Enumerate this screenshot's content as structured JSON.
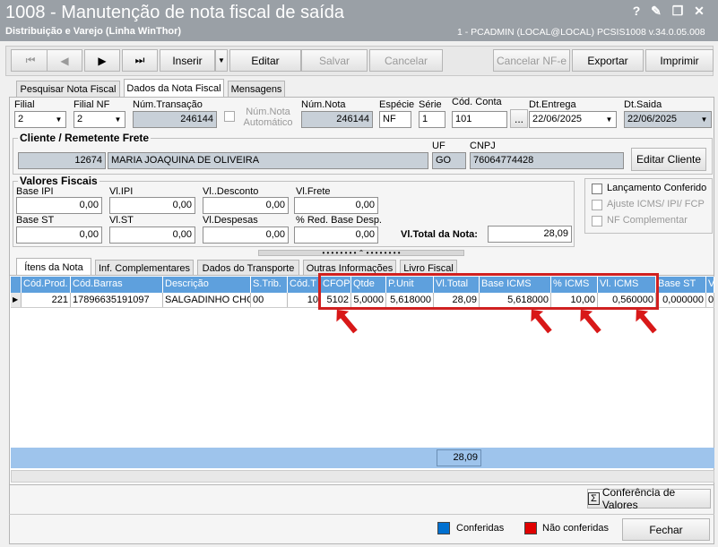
{
  "window": {
    "title": "1008 - Manutenção de nota fiscal de saída",
    "subtitle": "Distribuição e Varejo (Linha WinThor)",
    "user_info": "1 - PCADMIN (LOCAL@LOCAL)   PCSIS1008  v.34.0.05.008",
    "controls": [
      "?",
      "✎",
      "❐",
      "✕"
    ]
  },
  "toolbar": {
    "first": "⏮",
    "prev": "◀",
    "next": "▶",
    "last": "⏭",
    "inserir": "Inserir",
    "editar": "Editar",
    "salvar": "Salvar",
    "cancelar": "Cancelar",
    "cancelar_nfe": "Cancelar NF-e",
    "exportar": "Exportar",
    "imprimir": "Imprimir"
  },
  "main_tabs": [
    "Pesquisar Nota Fiscal",
    "Dados da Nota Fiscal",
    "Mensagens"
  ],
  "form": {
    "filial_label": "Filial",
    "filial_value": "2",
    "filial_nf_label": "Filial NF",
    "filial_nf_value": "2",
    "num_transacao_label": "Núm.Transação",
    "num_transacao_value": "246144",
    "num_nota_auto_label": "Núm.Nota Automático",
    "num_nota_label": "Núm.Nota",
    "num_nota_value": "246144",
    "especie_label": "Espécie",
    "especie_value": "NF",
    "serie_label": "Série",
    "serie_value": "1",
    "cod_conta_label": "Cód. Conta",
    "cod_conta_value": "101",
    "cod_conta_btn": "...",
    "dt_entrega_label": "Dt.Entrega",
    "dt_entrega_value": "22/06/2025",
    "dt_saida_label": "Dt.Saida",
    "dt_saida_value": "22/06/2025"
  },
  "cliente": {
    "title": "Cliente / Remetente Frete",
    "uf_label": "UF",
    "cnpj_label": "CNPJ",
    "codigo": "12674",
    "nome": "MARIA JOAQUINA DE OLIVEIRA",
    "uf": "GO",
    "cnpj": "76064774428",
    "editar_btn": "Editar Cliente"
  },
  "valores": {
    "title": "Valores Fiscais",
    "base_ipi_label": "Base IPI",
    "base_ipi": "0,00",
    "vl_ipi_label": "Vl.IPI",
    "vl_ipi": "0,00",
    "vl_desconto_label": "Vl..Desconto",
    "vl_desconto": "0,00",
    "vl_frete_label": "Vl.Frete",
    "vl_frete": "0,00",
    "base_st_label": "Base ST",
    "base_st": "0,00",
    "vl_st_label": "Vl.ST",
    "vl_st": "0,00",
    "vl_despesas_label": "Vl.Despesas",
    "vl_despesas": "0,00",
    "red_base_label": "% Red. Base Desp.",
    "red_base": "0,00",
    "vl_total_label": "Vl.Total da Nota:",
    "vl_total": "28,09"
  },
  "options": {
    "lancamento": "Lançamento Conferido",
    "ajuste": "Ajuste ICMS/ IPI/ FCP",
    "nf_complementar": "NF Complementar"
  },
  "item_tabs": [
    "Ítens da Nota",
    "Inf. Complementares",
    "Dados do Transporte",
    "Outras Informações",
    "Livro Fiscal"
  ],
  "grid": {
    "columns": [
      "Cód.Prod.",
      "Cód.Barras",
      "Descrição",
      "S.Trib.",
      "Cód.T",
      "CFOP",
      "Qtde",
      "P.Unit",
      "Vl.Total",
      "Base ICMS",
      "% ICMS",
      "Vl. ICMS",
      "Base ST",
      "V"
    ],
    "rows": [
      [
        "221",
        "17896635191097",
        "SALGADINHO CHOF",
        "00",
        "10",
        "5102",
        "5,0000",
        "5,618000",
        "28,09",
        "5,618000",
        "10,00",
        "0,560000",
        "0,000000",
        "0"
      ]
    ],
    "footer_total": "28,09"
  },
  "bottom": {
    "conferencia_btn": "Conferência de Valores",
    "legend_conferidas": "Conferidas",
    "legend_nao": "Não conferidas",
    "fechar_btn": "Fechar",
    "colors": {
      "conferidas": "#0070d0",
      "nao": "#e00000"
    }
  }
}
